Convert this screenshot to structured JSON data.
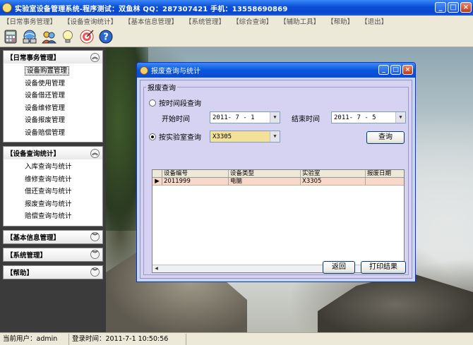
{
  "window": {
    "title": "实验室设备管理系统-程序测试：双鱼林 QQ：287307421 手机：13558690869",
    "controls": [
      "_",
      "□",
      "×"
    ]
  },
  "menu": [
    "【日常事务管理】",
    "【设备查询统计】",
    "【基本信息管理】",
    "【系统管理】",
    "【综合查询】",
    "【辅助工具】",
    "【帮助】",
    "【退出】"
  ],
  "toolbar": {
    "icons": [
      "calculator-icon",
      "network-icon",
      "users-icon",
      "lightbulb-icon",
      "target-icon",
      "help-icon"
    ]
  },
  "sidebar": {
    "panels": [
      {
        "title": "【日常事务管理】",
        "items": [
          "设备购置管理",
          "设备使用管理",
          "设备借还管理",
          "设备维修管理",
          "设备报废管理",
          "设备赔偿管理"
        ],
        "selected": 0
      },
      {
        "title": "【设备查询统计】",
        "items": [
          "入库查询与统计",
          "维修查询与统计",
          "借还查询与统计",
          "报废查询与统计",
          "赔偿查询与统计"
        ]
      },
      {
        "title": "【基本信息管理】",
        "items": []
      },
      {
        "title": "【系统管理】",
        "items": []
      },
      {
        "title": "【帮助】",
        "items": []
      }
    ]
  },
  "dialog": {
    "title": "报废查询与统计",
    "group_label": "报废查询",
    "radio_time": "按时间段查询",
    "start_label": "开始时间",
    "start_value": "2011- 7 - 1",
    "end_label": "结束时间",
    "end_value": "2011- 7 - 5",
    "radio_lab": "按实验室查询",
    "lab_value": "X3305",
    "query_button": "查询",
    "grid": {
      "columns": [
        "设备编号",
        "设备类型",
        "实验室",
        "报废日期"
      ],
      "rows": [
        [
          "2011999",
          "电脑",
          "X3305",
          ""
        ]
      ]
    },
    "back_button": "返回",
    "print_button": "打印结果"
  },
  "status": {
    "user": "当前用户：admin",
    "login": "登录时间：2011-7-1 10:50:56"
  }
}
